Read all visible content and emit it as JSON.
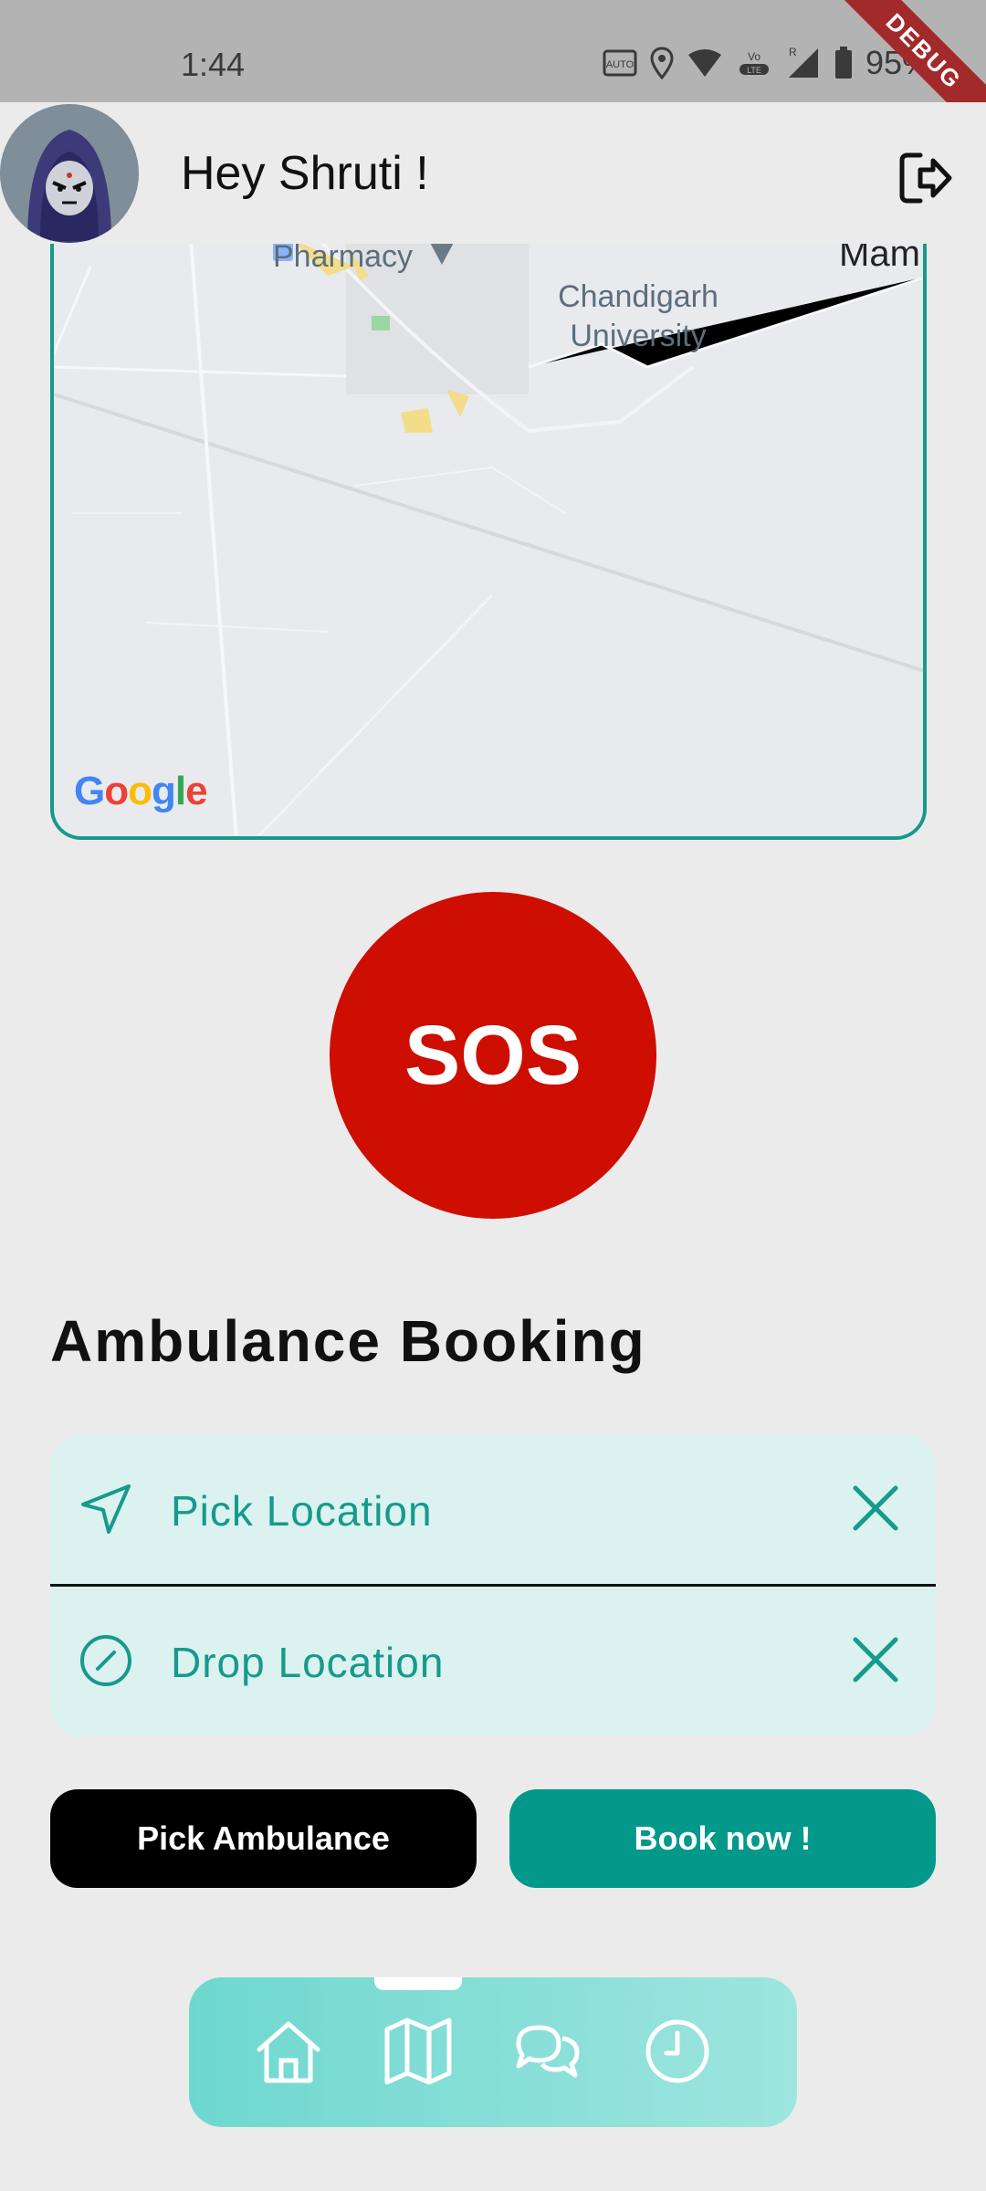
{
  "status_bar": {
    "time": "1:44",
    "battery": "95%",
    "icons": [
      "auto-hz-icon",
      "location-icon",
      "wifi-icon",
      "volte-icon",
      "signal-icon",
      "battery-icon"
    ],
    "debug_label": "DEBUG"
  },
  "header": {
    "greeting": "Hey Shruti !",
    "avatar": "avatar-image",
    "logout_icon": "logout-icon"
  },
  "map": {
    "labels": {
      "pharmacy": "Pharmacy",
      "university_line1": "Chandigarh",
      "university_line2": "University",
      "edge": "Mam"
    },
    "attribution": "Google",
    "border_color": "#169a8c"
  },
  "sos": {
    "label": "SOS",
    "color": "#cd0e00"
  },
  "booking": {
    "title": "Ambulance Booking",
    "pick_placeholder": "Pick Location",
    "drop_placeholder": "Drop Location",
    "field_bg": "#dbf2f0",
    "accent": "#169a8c"
  },
  "buttons": {
    "pick_ambulance": "Pick Ambulance",
    "book_now": "Book now !"
  },
  "bottom_nav": {
    "items": [
      "home-icon",
      "map-icon",
      "chat-icon",
      "history-icon"
    ],
    "selected": "map-icon"
  }
}
